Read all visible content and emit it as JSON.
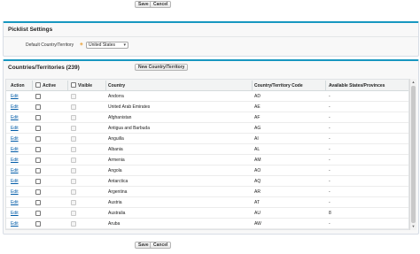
{
  "buttons": {
    "save": "Save",
    "cancel": "Cancel"
  },
  "picklist": {
    "title": "Picklist Settings",
    "default_label": "Default Country/Territory",
    "default_value": "United States"
  },
  "countries": {
    "title": "Countries/Territories (239)",
    "new_button": "New Country/Territory",
    "headers": {
      "action": "Action",
      "active": "Active",
      "visible": "Visible",
      "country": "Country",
      "code": "Country/Territory Code",
      "states": "Available States/Provinces"
    },
    "edit_label": "Edit",
    "rows": [
      {
        "name": "Andorra",
        "code": "AD",
        "states": "-"
      },
      {
        "name": "United Arab Emirates",
        "code": "AE",
        "states": "-"
      },
      {
        "name": "Afghanistan",
        "code": "AF",
        "states": "-"
      },
      {
        "name": "Antigua and Barbuda",
        "code": "AG",
        "states": "-"
      },
      {
        "name": "Anguilla",
        "code": "AI",
        "states": "-"
      },
      {
        "name": "Albania",
        "code": "AL",
        "states": "-"
      },
      {
        "name": "Armenia",
        "code": "AM",
        "states": "-"
      },
      {
        "name": "Angola",
        "code": "AO",
        "states": "-"
      },
      {
        "name": "Antarctica",
        "code": "AQ",
        "states": "-"
      },
      {
        "name": "Argentina",
        "code": "AR",
        "states": "-"
      },
      {
        "name": "Austria",
        "code": "AT",
        "states": "-"
      },
      {
        "name": "Australia",
        "code": "AU",
        "states": "8"
      },
      {
        "name": "Aruba",
        "code": "AW",
        "states": "-"
      }
    ]
  },
  "icons": {
    "required": "required-icon",
    "dropdown": "chevron-down-icon"
  }
}
